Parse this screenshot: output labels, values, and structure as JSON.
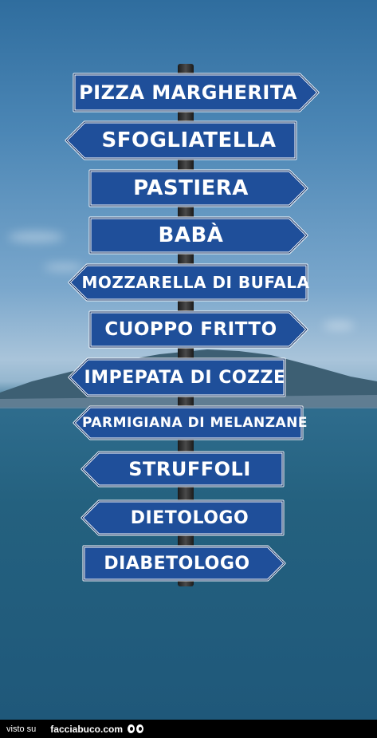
{
  "signs": [
    {
      "text": "PIZZA MARGHERITA",
      "dir": "right"
    },
    {
      "text": "SFOGLIATELLA",
      "dir": "left"
    },
    {
      "text": "PASTIERA",
      "dir": "right"
    },
    {
      "text": "BABÀ",
      "dir": "right"
    },
    {
      "text": "MOZZARELLA DI BUFALA",
      "dir": "left"
    },
    {
      "text": "CUOPPO FRITTO",
      "dir": "right"
    },
    {
      "text": "IMPEPATA DI COZZE",
      "dir": "left"
    },
    {
      "text": "PARMIGIANA DI MELANZANE",
      "dir": "left"
    },
    {
      "text": "STRUFFOLI",
      "dir": "left"
    },
    {
      "text": "DIETOLOGO",
      "dir": "left"
    },
    {
      "text": "DIABETOLOGO",
      "dir": "right"
    }
  ],
  "colors": {
    "sign_fill": "#1f4f9a",
    "sign_border": "#ffffff",
    "footer_bg": "#000000"
  },
  "footer": {
    "prefix": "visto su",
    "brand": "facciabuco.com"
  }
}
